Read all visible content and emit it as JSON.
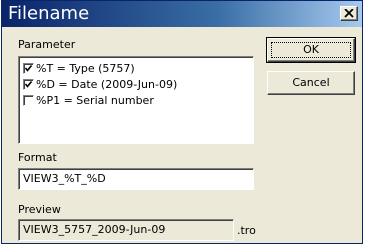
{
  "window": {
    "title": "Filename",
    "close_glyph": "✕"
  },
  "parameter_section": {
    "label": "Parameter",
    "items": [
      {
        "label": "%T = Type (5757)",
        "checked": true
      },
      {
        "label": "%D = Date (2009-Jun-09)",
        "checked": true
      },
      {
        "label": "%P1 = Serial number",
        "checked": false
      }
    ]
  },
  "format_section": {
    "label": "Format",
    "value": "VIEW3_%T_%D"
  },
  "preview_section": {
    "label": "Preview",
    "value": "VIEW3_5757_2009-Jun-09",
    "extension": ".tro"
  },
  "buttons": {
    "ok_label": "OK",
    "cancel_label": "Cancel"
  },
  "colors": {
    "title_bar_start": "#0a246a",
    "title_bar_end": "#a6caf0",
    "dialog_face": "#ece9d8"
  }
}
